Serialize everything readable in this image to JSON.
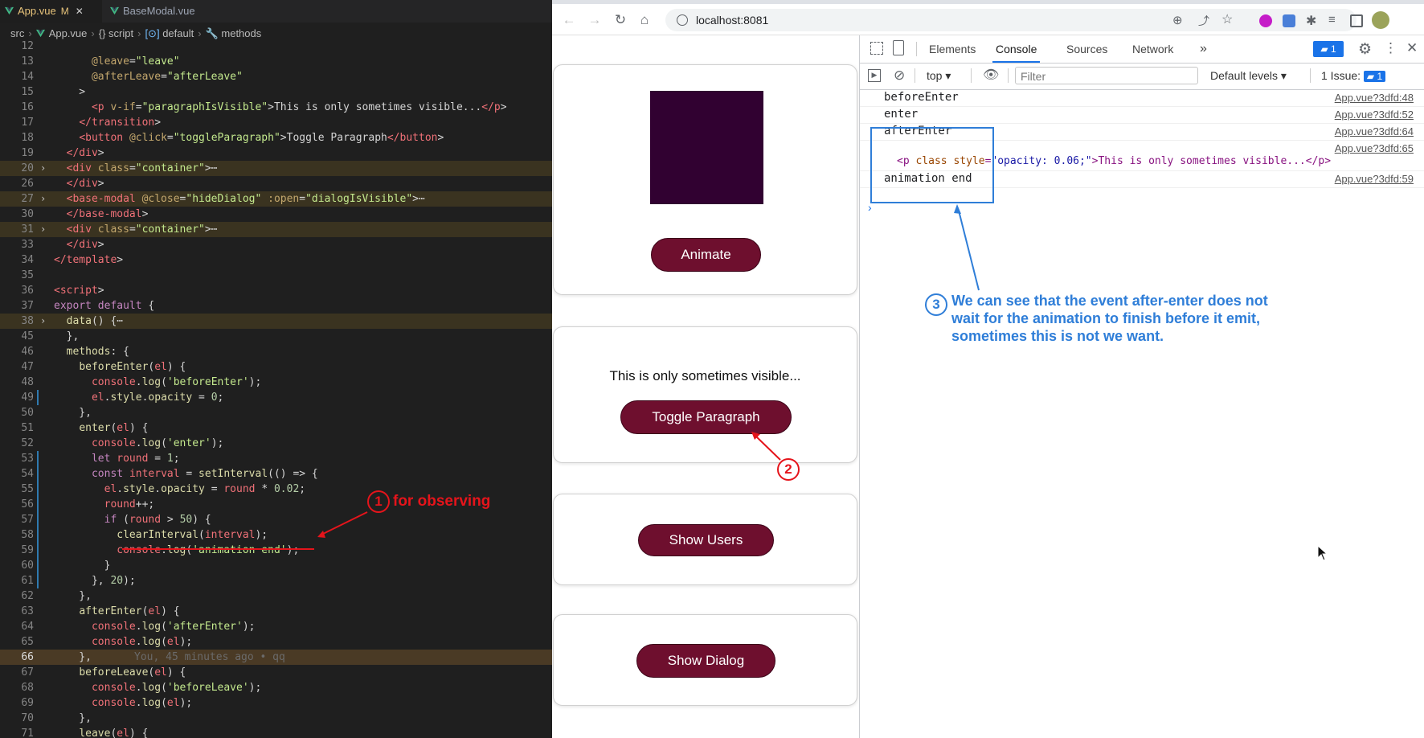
{
  "editor": {
    "tabs": [
      {
        "label": "App.vue",
        "status": "M",
        "active": true
      },
      {
        "label": "BaseModal.vue",
        "active": false
      }
    ],
    "breadcrumb": [
      "src",
      "App.vue",
      "{} script",
      "default",
      "methods"
    ]
  },
  "code_lines": [
    {
      "n": "12",
      "code": ""
    },
    {
      "n": "13",
      "code": "      @leave=\"leave\""
    },
    {
      "n": "14",
      "code": "      @afterLeave=\"afterLeave\""
    },
    {
      "n": "15",
      "code": "    >"
    },
    {
      "n": "16",
      "code": "      <p v-if=\"paragraphIsVisible\">This is only sometimes visible...</p>"
    },
    {
      "n": "17",
      "code": "    </transition>"
    },
    {
      "n": "18",
      "code": "    <button @click=\"toggleParagraph\">Toggle Paragraph</button>"
    },
    {
      "n": "19",
      "code": "  </div>"
    },
    {
      "n": "20",
      "code": "  <div class=\"container\">⋯"
    },
    {
      "n": "26",
      "code": "  </div>"
    },
    {
      "n": "27",
      "code": "  <base-modal @close=\"hideDialog\" :open=\"dialogIsVisible\">⋯"
    },
    {
      "n": "30",
      "code": "  </base-modal>"
    },
    {
      "n": "31",
      "code": "  <div class=\"container\">⋯"
    },
    {
      "n": "33",
      "code": "  </div>"
    },
    {
      "n": "34",
      "code": "</template>"
    },
    {
      "n": "35",
      "code": ""
    },
    {
      "n": "36",
      "code": "<script>"
    },
    {
      "n": "37",
      "code": "export default {"
    },
    {
      "n": "38",
      "code": "  data() {⋯"
    },
    {
      "n": "45",
      "code": "  },"
    },
    {
      "n": "46",
      "code": "  methods: {"
    },
    {
      "n": "47",
      "code": "    beforeEnter(el) {"
    },
    {
      "n": "48",
      "code": "      console.log('beforeEnter');"
    },
    {
      "n": "49",
      "code": "      el.style.opacity = 0;"
    },
    {
      "n": "50",
      "code": "    },"
    },
    {
      "n": "51",
      "code": "    enter(el) {"
    },
    {
      "n": "52",
      "code": "      console.log('enter');"
    },
    {
      "n": "53",
      "code": "      let round = 1;"
    },
    {
      "n": "54",
      "code": "      const interval = setInterval(() => {"
    },
    {
      "n": "55",
      "code": "        el.style.opacity = round * 0.02;"
    },
    {
      "n": "56",
      "code": "        round++;"
    },
    {
      "n": "57",
      "code": "        if (round > 50) {"
    },
    {
      "n": "58",
      "code": "          clearInterval(interval);"
    },
    {
      "n": "59",
      "code": "          console.log('animation end');"
    },
    {
      "n": "60",
      "code": "        }"
    },
    {
      "n": "61",
      "code": "      }, 20);"
    },
    {
      "n": "62",
      "code": "    },"
    },
    {
      "n": "63",
      "code": "    afterEnter(el) {"
    },
    {
      "n": "64",
      "code": "      console.log('afterEnter');"
    },
    {
      "n": "65",
      "code": "      console.log(el);"
    },
    {
      "n": "66",
      "code": "    },",
      "blame": "You, 45 minutes ago • qq"
    },
    {
      "n": "67",
      "code": "    beforeLeave(el) {"
    },
    {
      "n": "68",
      "code": "      console.log('beforeLeave');"
    },
    {
      "n": "69",
      "code": "      console.log(el);"
    },
    {
      "n": "70",
      "code": "    },"
    },
    {
      "n": "71",
      "code": "    leave(el) {"
    }
  ],
  "annotations": {
    "a1": {
      "number": "1",
      "text": "for observing"
    },
    "a2": {
      "number": "2"
    },
    "a3": {
      "number": "3",
      "lines": [
        "We can see that the event after-enter does not",
        "wait for the animation to finish before it emit,",
        "sometimes this is not we want."
      ]
    }
  },
  "browser": {
    "url": "localhost:8081",
    "page": {
      "animate_label": "Animate",
      "paragraph_text": "This is only sometimes visible...",
      "toggle_label": "Toggle Paragraph",
      "users_label": "Show Users",
      "dialog_label": "Show Dialog"
    },
    "devtools": {
      "tabs": [
        "Elements",
        "Console",
        "Sources",
        "Network"
      ],
      "active_tab": "Console",
      "message_badge": "1",
      "context": "top",
      "filter_placeholder": "Filter",
      "levels": "Default levels",
      "issues_label": "1 Issue:",
      "issues_count": "1",
      "logs": [
        {
          "msg": "beforeEnter",
          "src": "App.vue?3dfd:48"
        },
        {
          "msg": "enter",
          "src": "App.vue?3dfd:52"
        },
        {
          "msg": "afterEnter",
          "src": "App.vue?3dfd:64"
        },
        {
          "msg": "",
          "src": "App.vue?3dfd:65"
        },
        {
          "msg": "animation end",
          "src": "App.vue?3dfd:59"
        }
      ],
      "element_log": {
        "open": "<p class style=",
        "style": "\"opacity: 0.06;\"",
        "rest": ">This is only sometimes visible...</p>"
      }
    }
  },
  "colors": {
    "accent_red": "#e5141b",
    "accent_blue": "#2f7ed8",
    "button": "#6e0f2e",
    "box": "#310131"
  }
}
